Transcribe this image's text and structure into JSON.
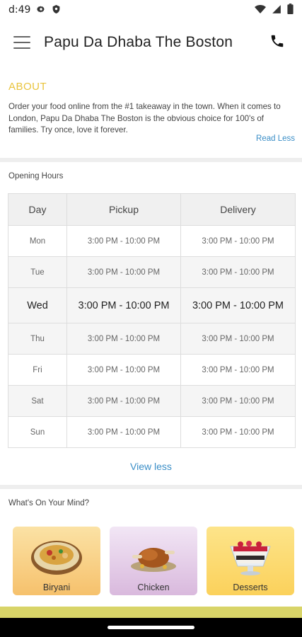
{
  "status_bar": {
    "time": "d:49",
    "icons": [
      "gear-icon",
      "shield-icon",
      "wifi-icon",
      "signal-icon",
      "battery-icon"
    ]
  },
  "app_bar": {
    "title": "Papu Da Dhaba The Boston",
    "menu_icon": "hamburger-menu-icon",
    "call_icon": "phone-icon"
  },
  "about": {
    "heading": "ABOUT",
    "text": "Order your food online from the #1 takeaway in the town. When it comes to London, Papu Da Dhaba The Boston is the obvious choice for 100's of families. Try once, love it forever.",
    "read_less": "Read Less"
  },
  "opening_hours": {
    "title": "Opening Hours",
    "headers": [
      "Day",
      "Pickup",
      "Delivery"
    ],
    "rows": [
      {
        "day": "Mon",
        "pickup": "3:00 PM - 10:00 PM",
        "delivery": "3:00 PM - 10:00 PM"
      },
      {
        "day": "Tue",
        "pickup": "3:00 PM - 10:00 PM",
        "delivery": "3:00 PM - 10:00 PM"
      },
      {
        "day": "Wed",
        "pickup": "3:00 PM - 10:00 PM",
        "delivery": "3:00 PM - 10:00 PM"
      },
      {
        "day": "Thu",
        "pickup": "3:00 PM - 10:00 PM",
        "delivery": "3:00 PM - 10:00 PM"
      },
      {
        "day": "Fri",
        "pickup": "3:00 PM - 10:00 PM",
        "delivery": "3:00 PM - 10:00 PM"
      },
      {
        "day": "Sat",
        "pickup": "3:00 PM - 10:00 PM",
        "delivery": "3:00 PM - 10:00 PM"
      },
      {
        "day": "Sun",
        "pickup": "3:00 PM - 10:00 PM",
        "delivery": "3:00 PM - 10:00 PM"
      }
    ],
    "highlighted_day": "Wed",
    "view_less": "View less"
  },
  "categories": {
    "title": "What's On Your Mind?",
    "items": [
      {
        "label": "Biryani",
        "icon": "biryani-plate-icon"
      },
      {
        "label": "Chicken",
        "icon": "roast-chicken-icon"
      },
      {
        "label": "Desserts",
        "icon": "dessert-bowl-icon"
      }
    ]
  },
  "colors": {
    "accent_heading": "#e9c43d",
    "link": "#3a8ec7",
    "divider": "#eeeeee",
    "bottom_strip": "#d8d468"
  }
}
